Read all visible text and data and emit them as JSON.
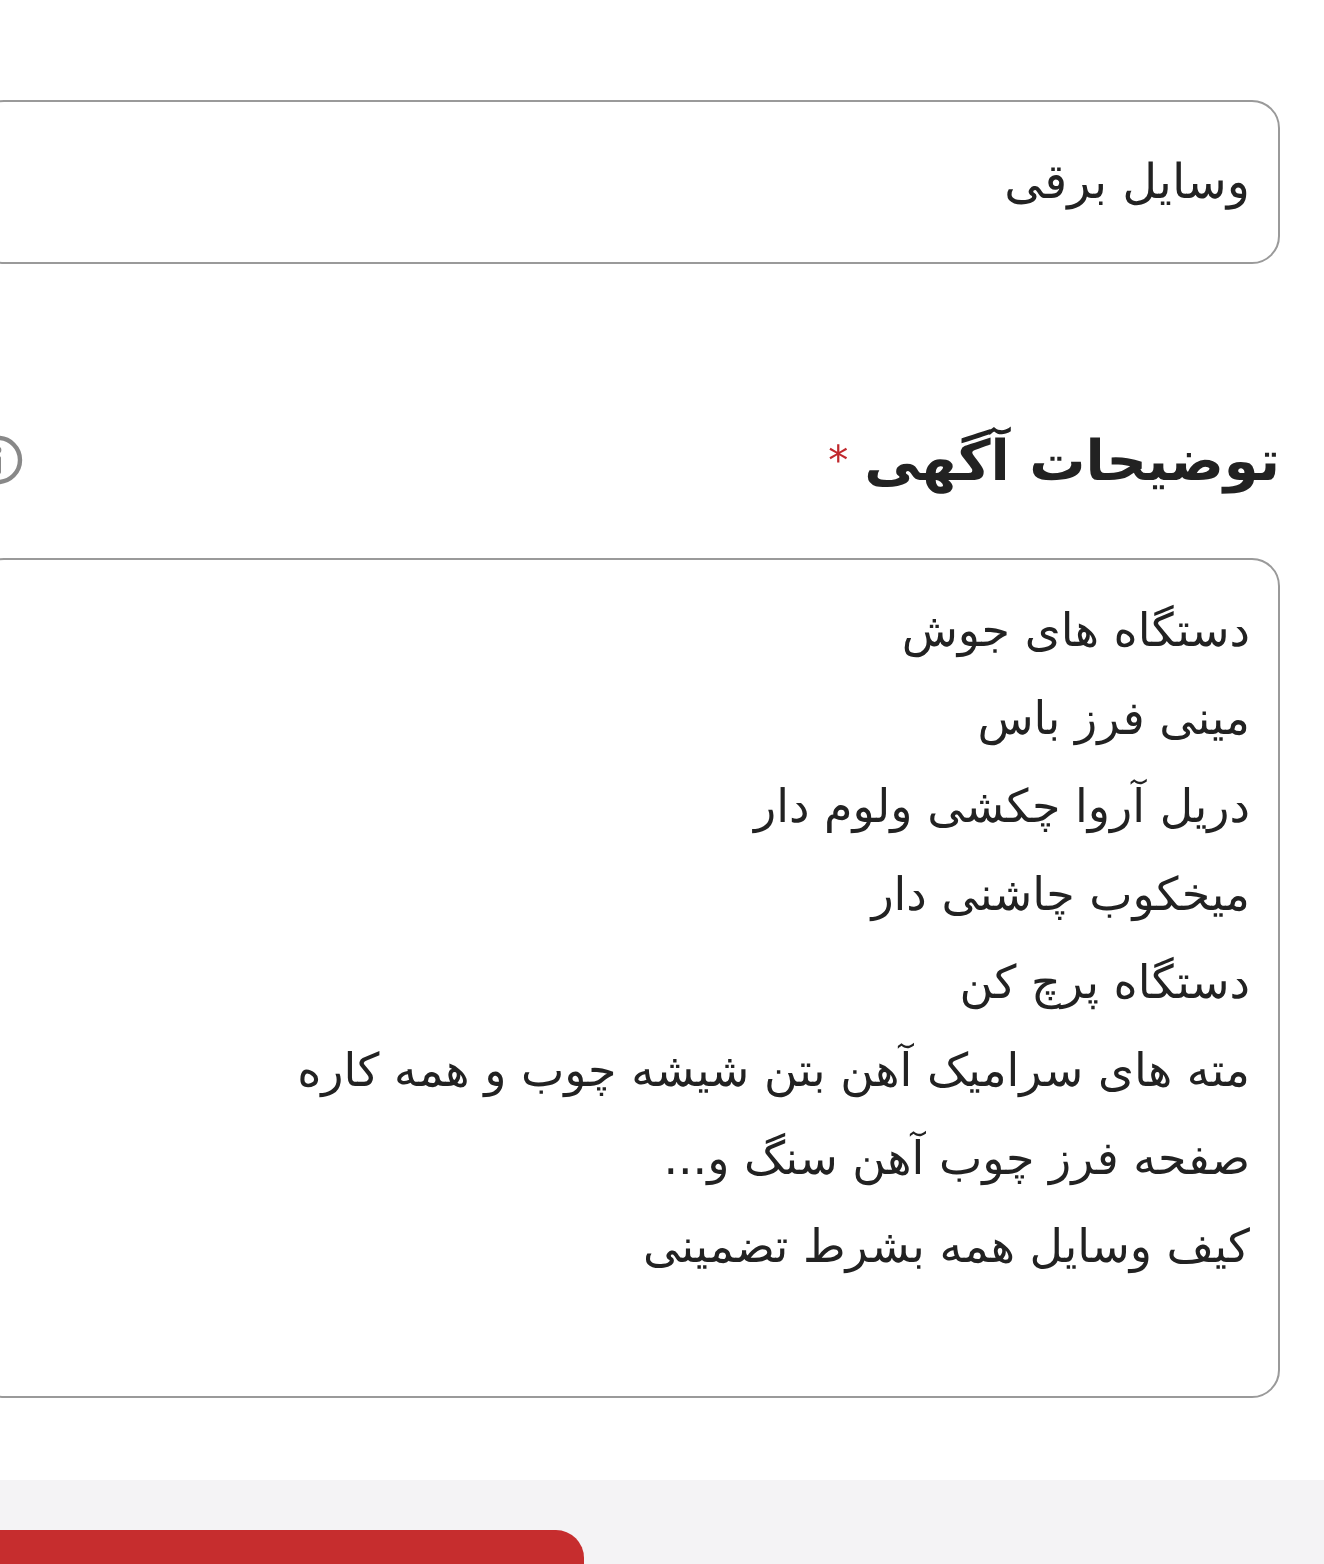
{
  "category_field": {
    "value": "وسایل برقی"
  },
  "description": {
    "label": "توضیحات آگهی",
    "required_mark": "*",
    "lines": [
      "دستگاه های جوش",
      "مینی فرز باس",
      "دریل آروا چکشی ولوم دار",
      "میخکوب چاشنی دار",
      "دستگاه پرچ کن",
      "مته های سرامیک آهن بتن شیشه چوب و همه کاره",
      "صفحه فرز چوب آهن سنگ و...",
      "کیف وسایل همه بشرط تضمینی"
    ]
  }
}
